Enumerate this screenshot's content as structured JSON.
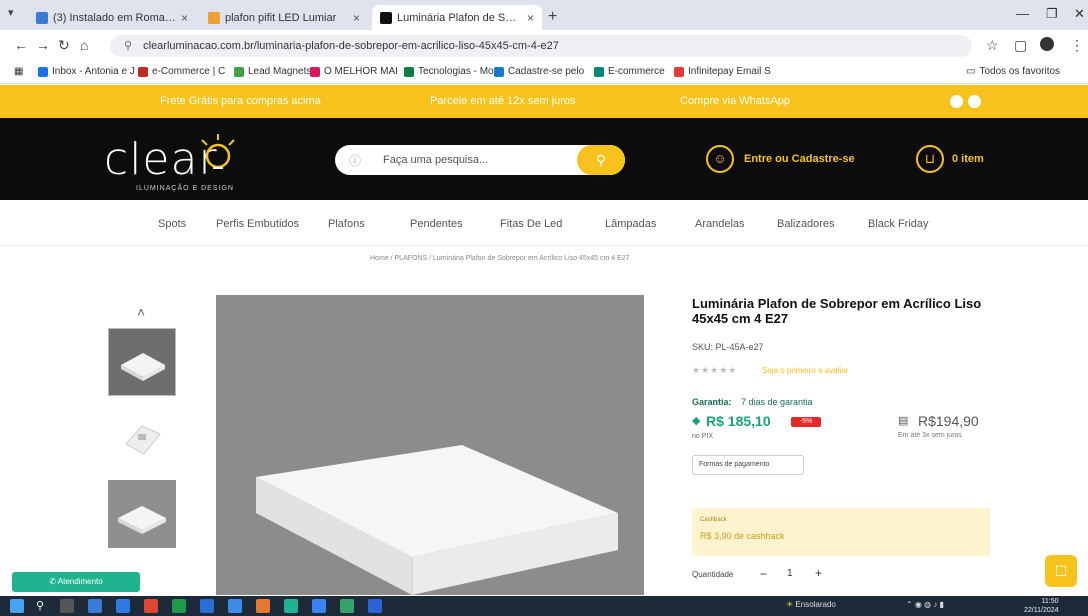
{
  "browser": {
    "tabs": [
      {
        "title": "(3) Instalado em Roma Ron"
      },
      {
        "title": "plafon pifit LED Lumiar"
      },
      {
        "title": "Luminária Plafon de Sobrepor"
      }
    ],
    "new_tab_symbol": "+",
    "url": "clearluminacao.com.br/luminaria-plafon-de-sobrepor-em-acrilico-liso-45x45-cm-4-e27",
    "bookmarks": [
      {
        "label": "Inbox - Antonia e J"
      },
      {
        "label": "e-Commerce | C"
      },
      {
        "label": "Lead Magnets"
      },
      {
        "label": "O MELHOR MAI"
      },
      {
        "label": "Tecnologias - Mo"
      },
      {
        "label": "Cadastre-se pelo"
      },
      {
        "label": "E-commerce"
      },
      {
        "label": "Infinitepay Email S"
      }
    ],
    "all_bookmarks": "Todos os favoritos"
  },
  "promo": {
    "left": "Frete Grátis para compras acima",
    "center": "Parcele em até 12x sem juros",
    "right": "Compre via WhatsApp"
  },
  "header": {
    "logo_text": "clear",
    "logo_sub": "ILUMINAÇÃO E DESIGN",
    "search_placeholder": "Faça uma pesquisa...",
    "account_label": "Entre ou Cadastre-se",
    "cart_label": "0 item"
  },
  "nav": [
    "Spots",
    "Perfis Embutidos",
    "Plafons",
    "Pendentes",
    "Fitas De Led",
    "Lâmpadas",
    "Arandelas",
    "Balizadores",
    "Black Friday"
  ],
  "breadcrumb": "Home  /  PLAFONS  /  Luminária Plafon de Sobrepor em Acrílico Liso 45x45 cm 4 E27",
  "product": {
    "title": "Luminária Plafon de Sobrepor em Acrílico Liso 45x45 cm 4 E27",
    "sku": "SKU: PL-45A-e27",
    "stars": "★★★★★",
    "reviews": "Seja o primeiro a avaliar",
    "garantia_label": "Garantia:",
    "garantia_value": "7 dias de garantia",
    "pix_price": "R$ 185,10",
    "pix_badge": "-5%",
    "pix_note": "no PIX",
    "card_price": "R$194,90",
    "card_note": "Em até 3x sem juros",
    "payment_forms": "Formas de pagamento",
    "cashback_label": "Cashback",
    "cashback_value": "R$ 3,90 de cashback",
    "qty_label": "Quantidade",
    "qty_value": "1",
    "qty_minus": "−",
    "qty_plus": "+"
  },
  "widgets": {
    "whatsapp": "Atendimento"
  },
  "taskbar": {
    "weather": "Ensolarado",
    "clock_time": "11:50",
    "clock_date": "22/11/2024"
  },
  "colors": {
    "brand_yellow": "#f7c21b",
    "header_black": "#0c0c0c",
    "pix_green": "#1aa37a",
    "sale_red": "#e62a2a"
  }
}
